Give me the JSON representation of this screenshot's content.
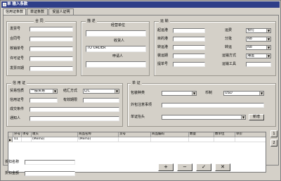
{
  "window": {
    "title": "单 输入条款"
  },
  "tabs": [
    "信用证条款",
    "单证条款",
    "受益人证明"
  ],
  "contract": {
    "title": "合  同",
    "fields": [
      {
        "label": "发票号",
        "value": ""
      },
      {
        "label": "合同号",
        "value": ""
      },
      {
        "label": "核销单号",
        "value": ""
      },
      {
        "label": "许可证号",
        "value": ""
      },
      {
        "label": "发票日期",
        "value": ""
      }
    ]
  },
  "description": {
    "title": "描  述",
    "labels": [
      "经营单位",
      "收货人",
      "申请人"
    ],
    "consignee_value": "TO ORDER"
  },
  "transport": {
    "title": "运  输",
    "left_labels": [
      "起运港",
      "目的港",
      "转运港",
      "装运期",
      "提单号"
    ],
    "right_labels": [
      "运费",
      "分批",
      "转运",
      "运输方式",
      "运输工具"
    ],
    "right_values": [
      "预付",
      "No",
      "No",
      "海运",
      ""
    ]
  },
  "credit": {
    "title": "信 用 证",
    "labels": [
      "贸易性质",
      "信用证号",
      "成交条件",
      "通知人"
    ],
    "trade_value": "一般贸易",
    "pay_label": "结汇方式",
    "pay_value": "L/C",
    "valid_label": "有效期限"
  },
  "doc": {
    "title": "单  证",
    "labels": [
      "包装种类",
      "外包注意事项",
      "单证抬头"
    ],
    "currency_label": "币制",
    "currency_value": "USD",
    "add_label": "新增"
  },
  "grid": {
    "headers": [
      "序号",
      "项号",
      "唛头",
      "商品名称",
      "货号",
      "商品编码",
      "数量",
      "数单位",
      "单价"
    ],
    "rows": [
      [
        "01",
        "",
        "(Memo)",
        "(Memo)",
        "",
        "",
        "",
        "",
        ""
      ]
    ]
  },
  "side_buttons": [
    "1",
    "2"
  ],
  "footer": {
    "discount_name_label": "折扣名称",
    "discount_amount_label": "折扣金额",
    "nav": [
      "+",
      "−",
      "✓",
      "✕"
    ]
  }
}
